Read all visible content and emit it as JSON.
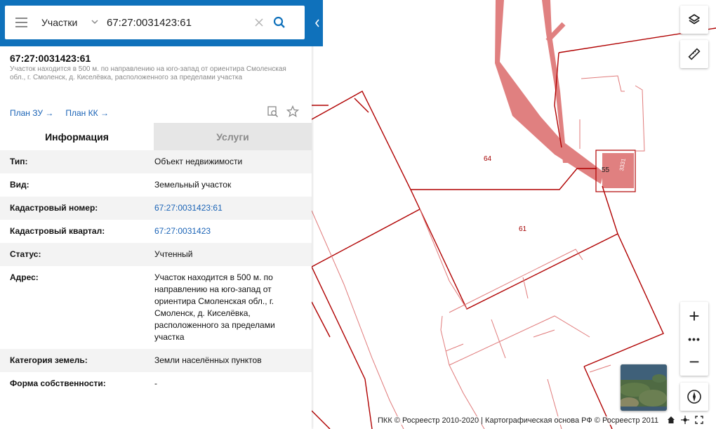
{
  "search": {
    "type_label": "Участки",
    "value": "67:27:0031423:61",
    "placeholder": ""
  },
  "object": {
    "title": "67:27:0031423:61",
    "description": "Участок находится в 500 м. по направлению на юго-запад от ориентира Смоленская обл., г. Смоленск, д. Киселёвка, расположенного за пределами участка"
  },
  "links": {
    "plan_zu": "План ЗУ",
    "plan_kk": "План КК"
  },
  "tabs": {
    "info": "Информация",
    "services": "Услуги"
  },
  "info_rows": [
    {
      "key": "Тип:",
      "value": "Объект недвижимости"
    },
    {
      "key": "Вид:",
      "value": "Земельный участок"
    },
    {
      "key": "Кадастровый номер:",
      "value": "67:27:0031423:61"
    },
    {
      "key": "Кадастровый квартал:",
      "value": "67:27:0031423"
    },
    {
      "key": "Статус:",
      "value": "Учтенный"
    },
    {
      "key": "Адрес:",
      "value": "Участок находится в 500 м. по направлению на юго-запад от ориентира Смоленская обл., г. Смоленск, д. Киселёвка, расположенного за пределами участка"
    },
    {
      "key": "Категория земель:",
      "value": "Земли населённых пунктов"
    },
    {
      "key": "Форма собственности:",
      "value": "-"
    }
  ],
  "map": {
    "parcel_labels": {
      "p64": "64",
      "p61": "61",
      "p55": "55",
      "p3331": "3331"
    },
    "attribution": "ПКК © Росреестр 2010-2020 | Картографическая основа РФ © Росреестр 2011",
    "parcel_color": "#b00000",
    "road_color": "#e07a7a"
  },
  "icons": {
    "menu": "hamburger-icon",
    "search": "search-icon",
    "clear": "close-icon",
    "layers": "layers-icon",
    "ruler": "ruler-icon",
    "zoom_in": "plus-icon",
    "zoom_out": "minus-icon",
    "compass": "compass-icon"
  },
  "colors": {
    "header_blue": "#0f71bb",
    "link_blue": "#1a63b6"
  }
}
